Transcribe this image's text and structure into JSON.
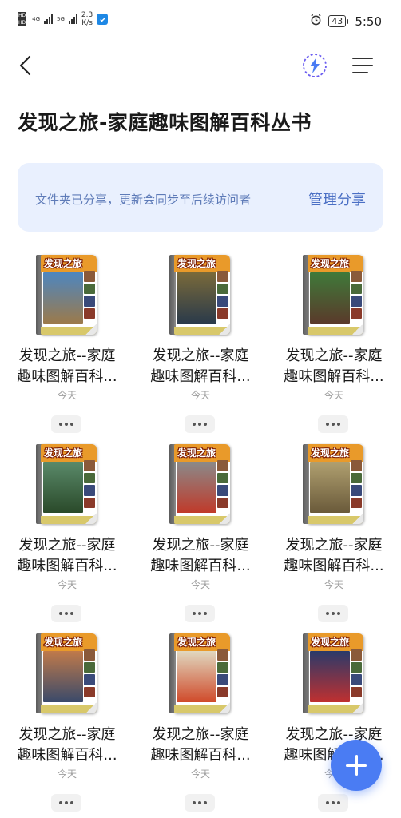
{
  "status_bar": {
    "sim1": "4G",
    "sim2": "5G",
    "net_speed_value": "2.3",
    "net_speed_unit": "K/s",
    "battery": "43",
    "time": "5:50",
    "alarm_icon": "alarm-clock-icon"
  },
  "header": {
    "back_icon": "chevron-left-icon",
    "flash_icon": "lightning-icon",
    "menu_icon": "menu-lines-icon"
  },
  "page_title": "发现之旅-家庭趣味图解百科丛书",
  "share_banner": {
    "text": "文件夹已分享，更新会同步至后续访问者",
    "action": "管理分享"
  },
  "items": [
    {
      "cover_title": "发现之旅",
      "name_line1": "发现之旅--家庭",
      "name_line2": "趣味图解百科...",
      "date": "今天",
      "art_top": "#4d86c0",
      "art_bottom": "#9c7a4a",
      "head_color": "#e99a2a"
    },
    {
      "cover_title": "发现之旅",
      "name_line1": "发现之旅--家庭",
      "name_line2": "趣味图解百科...",
      "date": "今天",
      "art_top": "#7a6a3a",
      "art_bottom": "#2a3a4a",
      "head_color": "#e99a2a"
    },
    {
      "cover_title": "发现之旅",
      "name_line1": "发现之旅--家庭",
      "name_line2": "趣味图解百科...",
      "date": "今天",
      "art_top": "#3f7a3a",
      "art_bottom": "#5a3a2a",
      "head_color": "#e99a2a"
    },
    {
      "cover_title": "发现之旅",
      "name_line1": "发现之旅--家庭",
      "name_line2": "趣味图解百科...",
      "date": "今天",
      "art_top": "#5a8a6a",
      "art_bottom": "#2a4a2a",
      "head_color": "#e99a2a"
    },
    {
      "cover_title": "发现之旅",
      "name_line1": "发现之旅--家庭",
      "name_line2": "趣味图解百科...",
      "date": "今天",
      "art_top": "#8a8a8a",
      "art_bottom": "#c03a2a",
      "head_color": "#e99a2a"
    },
    {
      "cover_title": "发现之旅",
      "name_line1": "发现之旅--家庭",
      "name_line2": "趣味图解百科...",
      "date": "今天",
      "art_top": "#b0a070",
      "art_bottom": "#6a5a3a",
      "head_color": "#e99a2a"
    },
    {
      "cover_title": "发现之旅",
      "name_line1": "发现之旅--家庭",
      "name_line2": "趣味图解百科...",
      "date": "今天",
      "art_top": "#c07a4a",
      "art_bottom": "#3a4a6a",
      "head_color": "#e99a2a"
    },
    {
      "cover_title": "发现之旅",
      "name_line1": "发现之旅--家庭",
      "name_line2": "趣味图解百科...",
      "date": "今天",
      "art_top": "#e0d8c0",
      "art_bottom": "#d04a2a",
      "head_color": "#e99a2a"
    },
    {
      "cover_title": "发现之旅",
      "name_line1": "发现之旅--家庭",
      "name_line2": "趣味图解百科...",
      "date": "今天",
      "art_top": "#2a3a6a",
      "art_bottom": "#c03030",
      "head_color": "#e99a2a"
    }
  ],
  "fab": {
    "icon": "plus-icon",
    "color": "#4a7cf3"
  },
  "colors": {
    "accent": "#4a7cf3",
    "banner_bg": "#e9f0fe",
    "banner_text": "#5e7bb8"
  }
}
